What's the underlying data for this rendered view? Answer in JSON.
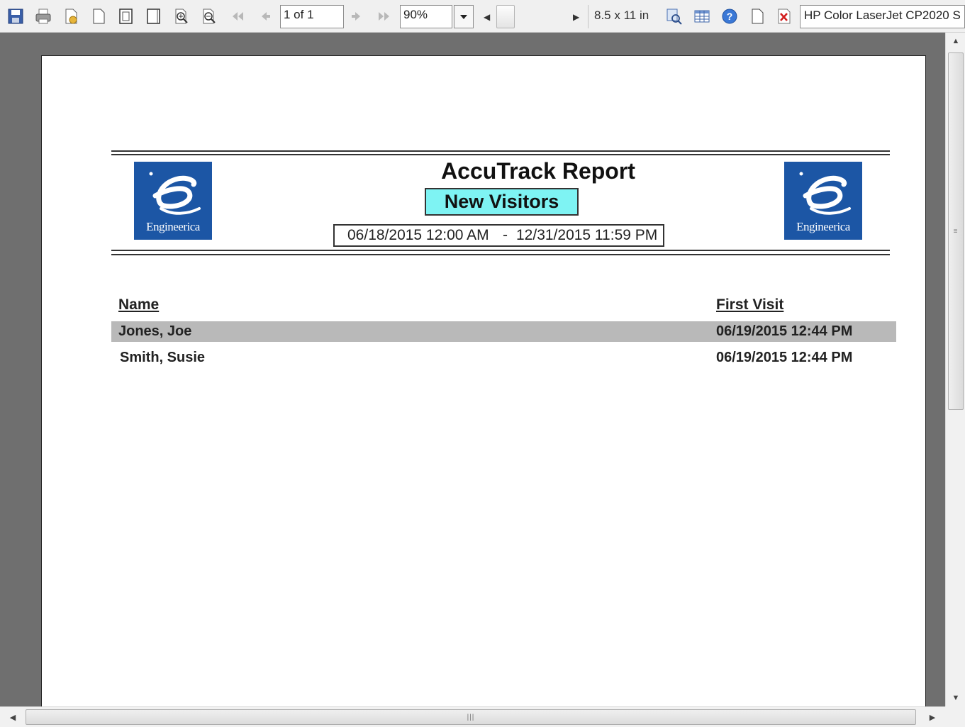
{
  "toolbar": {
    "page_indicator": "1 of 1",
    "zoom": "90%",
    "paper_size": "8.5 x 11 in",
    "printer": "HP Color LaserJet CP2020 S",
    "icons": [
      "save-icon",
      "print-icon",
      "page-setup-icon",
      "single-page-icon",
      "two-page-icon",
      "multi-page-icon",
      "zoom-in-icon",
      "zoom-out-icon",
      "first-page-icon",
      "prev-page-icon",
      "next-page-icon",
      "last-page-icon",
      "zoom-dropdown-icon",
      "find-icon",
      "export-grid-icon",
      "help-icon",
      "blank-page-icon",
      "close-icon"
    ]
  },
  "report": {
    "title": "AccuTrack Report",
    "subtitle": "New Visitors",
    "date_from": "06/18/2015 12:00 AM",
    "date_sep": "-",
    "date_to": "12/31/2015 11:59 PM",
    "logo_text": "Engineerica",
    "columns": {
      "name": "Name",
      "first_visit": "First Visit"
    },
    "rows": [
      {
        "name": "Jones, Joe",
        "first_visit": "06/19/2015 12:44 PM"
      },
      {
        "name": "Smith, Susie",
        "first_visit": "06/19/2015 12:44 PM"
      }
    ]
  },
  "colors": {
    "subtitle_bg": "#7ef3f3",
    "logo_bg": "#1c56a5",
    "shaded_row": "#b9b9b9",
    "viewport_bg": "#6f6f6f"
  }
}
